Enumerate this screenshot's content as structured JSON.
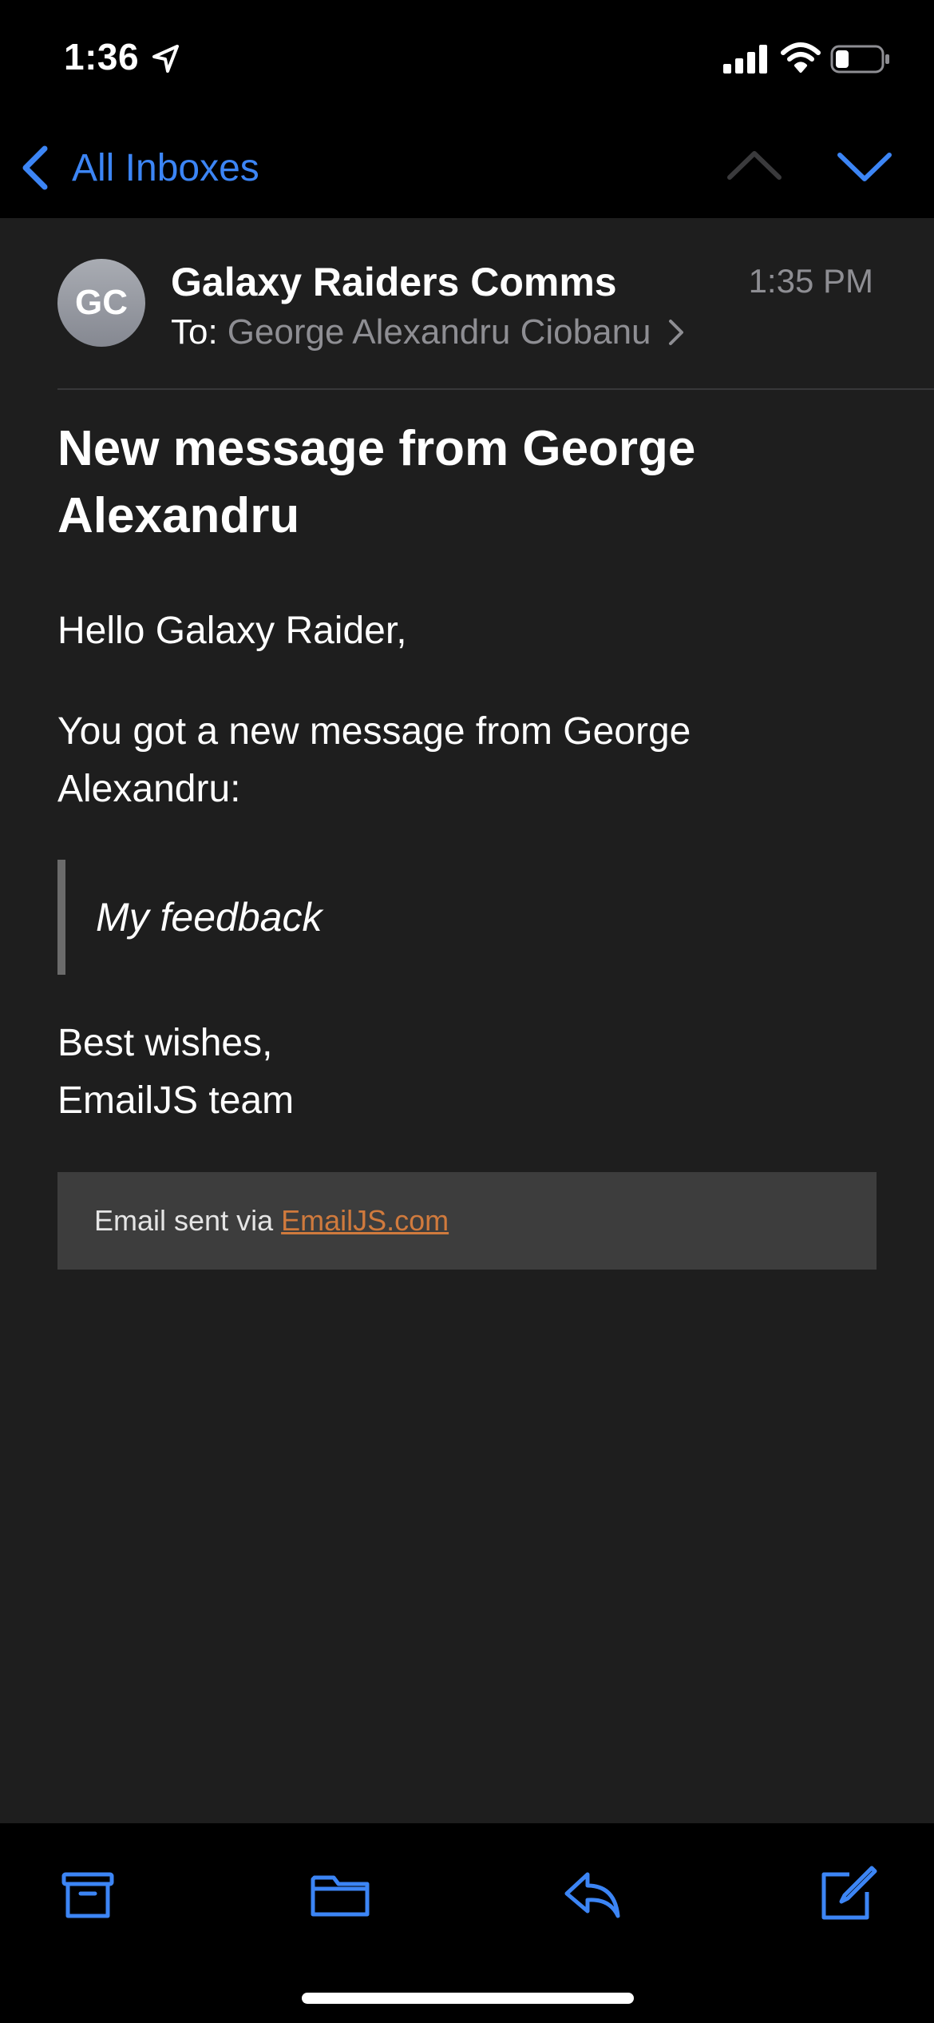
{
  "status_bar": {
    "time": "1:36"
  },
  "nav": {
    "back_label": "All Inboxes"
  },
  "email": {
    "avatar_initials": "GC",
    "sender": "Galaxy Raiders Comms",
    "time": "1:35 PM",
    "to_label": "To:",
    "recipient": "George Alexandru Ciobanu",
    "subject": "New message from George Alexandru",
    "greeting": "Hello Galaxy Raider,",
    "intro": "You got a new message from George Alexandru:",
    "quote": "My feedback",
    "signoff_line1": "Best wishes,",
    "signoff_line2": "EmailJS team",
    "footer_prefix": "Email sent via",
    "footer_link": "EmailJS.com"
  },
  "colors": {
    "accent": "#3c85f5",
    "link": "#d07a3d",
    "background": "#1e1e1e"
  }
}
